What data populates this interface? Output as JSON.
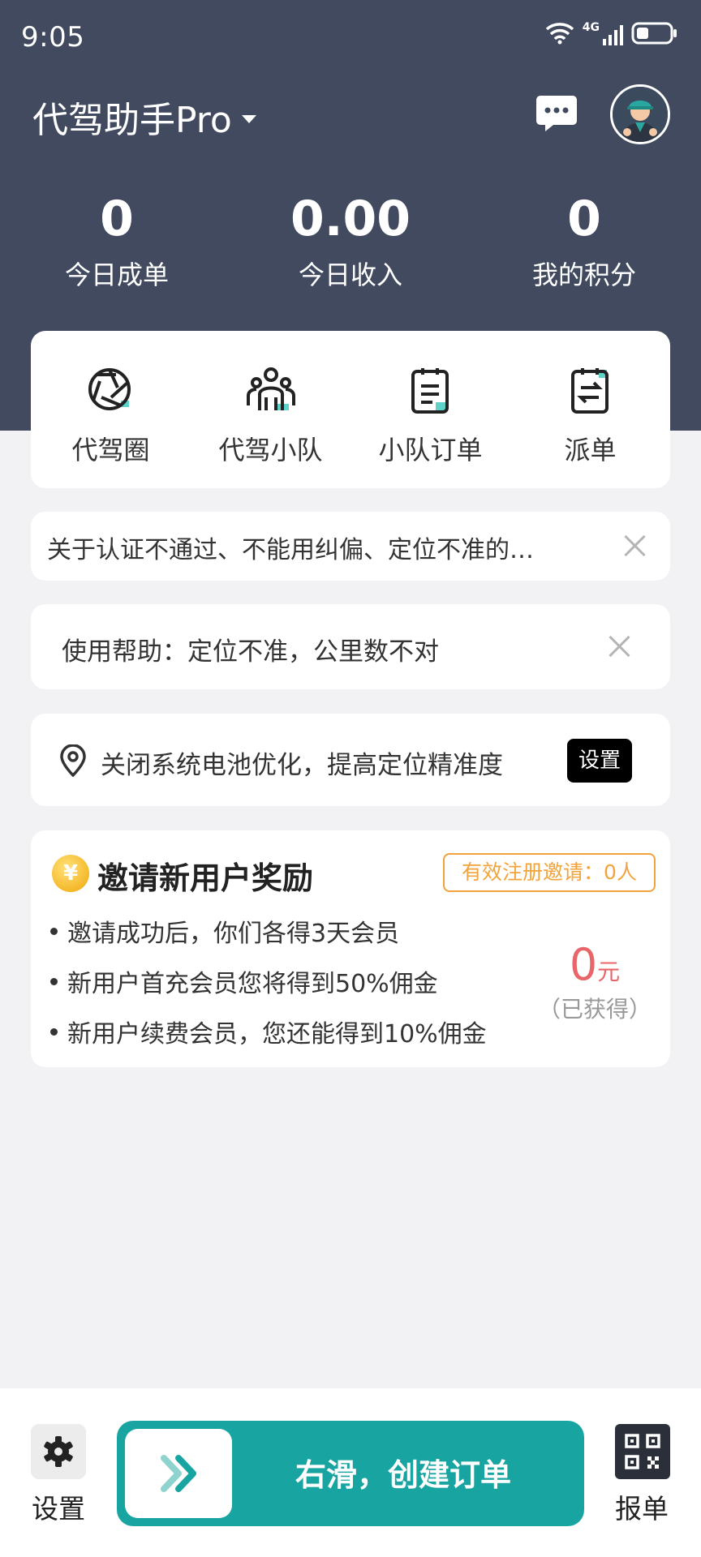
{
  "status_bar": {
    "time": "9:05",
    "network": "4G"
  },
  "header": {
    "app_title": "代驾助手Pro",
    "stats": [
      {
        "value": "0",
        "label": "今日成单"
      },
      {
        "value": "0.00",
        "label": "今日收入"
      },
      {
        "value": "0",
        "label": "我的积分"
      }
    ]
  },
  "quick_actions": [
    {
      "label": "代驾圈",
      "icon": "aperture-icon"
    },
    {
      "label": "代驾小队",
      "icon": "team-icon"
    },
    {
      "label": "小队订单",
      "icon": "clipboard-list-icon"
    },
    {
      "label": "派单",
      "icon": "clipboard-dispatch-icon"
    }
  ],
  "notices": {
    "announcement": "关于认证不通过、不能用纠偏、定位不准的…",
    "help": "使用帮助：定位不准，公里数不对",
    "battery_tip": "关闭系统电池优化，提高定位精准度",
    "battery_button": "设置"
  },
  "invite": {
    "coin_symbol": "¥",
    "title": "邀请新用户奖励",
    "badge": "有效注册邀请：0人",
    "bullets": [
      "邀请成功后，你们各得3天会员",
      "新用户首充会员您将得到50%佣金",
      "新用户续费会员，您还能得到10%佣金"
    ],
    "reward_amount": "0",
    "reward_unit": "元",
    "reward_note": "（已获得）"
  },
  "bottom_bar": {
    "settings_label": "设置",
    "slide_label": "右滑，创建订单",
    "report_label": "报单"
  },
  "colors": {
    "header_bg": "#414a5e",
    "accent": "#18a5a1",
    "orange": "#f2a33b",
    "reward_red": "#e8666a"
  }
}
